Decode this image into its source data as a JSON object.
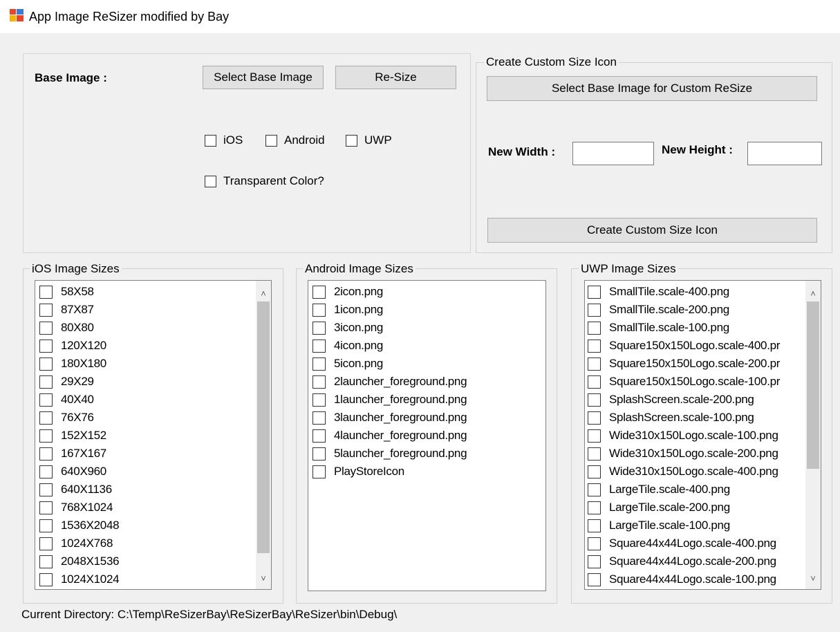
{
  "window": {
    "title": "App Image ReSizer modified by Bay",
    "icon": "app-icon"
  },
  "base_panel": {
    "label": "Base Image :",
    "select_button": "Select Base Image",
    "resize_button": "Re-Size",
    "platforms": [
      {
        "label": "iOS",
        "checked": false
      },
      {
        "label": "Android",
        "checked": false
      },
      {
        "label": "UWP",
        "checked": false
      }
    ],
    "transparent_label": "Transparent Color?"
  },
  "custom": {
    "legend": "Create Custom Size Icon",
    "select_button": "Select Base Image for Custom ReSize",
    "width_label": "New Width :",
    "height_label": "New Height :",
    "width_value": "",
    "height_value": "",
    "create_button": "Create Custom Size Icon"
  },
  "ios": {
    "legend": "iOS Image Sizes",
    "items": [
      "58X58",
      "87X87",
      "80X80",
      "120X120",
      "180X180",
      "29X29",
      "40X40",
      "76X76",
      "152X152",
      "167X167",
      "640X960",
      "640X1136",
      "768X1024",
      "1536X2048",
      "1024X768",
      "2048X1536",
      "1024X1024"
    ]
  },
  "android": {
    "legend": "Android Image Sizes",
    "items": [
      "2icon.png",
      "1icon.png",
      "3icon.png",
      "4icon.png",
      "5icon.png",
      "2launcher_foreground.png",
      "1launcher_foreground.png",
      "3launcher_foreground.png",
      "4launcher_foreground.png",
      "5launcher_foreground.png",
      "PlayStoreIcon"
    ]
  },
  "uwp": {
    "legend": "UWP Image Sizes",
    "items": [
      "SmallTile.scale-400.png",
      "SmallTile.scale-200.png",
      "SmallTile.scale-100.png",
      "Square150x150Logo.scale-400.pr",
      "Square150x150Logo.scale-200.pr",
      "Square150x150Logo.scale-100.pr",
      "SplashScreen.scale-200.png",
      "SplashScreen.scale-100.png",
      "Wide310x150Logo.scale-100.png",
      "Wide310x150Logo.scale-200.png",
      "Wide310x150Logo.scale-400.png",
      "LargeTile.scale-400.png",
      "LargeTile.scale-200.png",
      "LargeTile.scale-100.png",
      "Square44x44Logo.scale-400.png",
      "Square44x44Logo.scale-200.png",
      "Square44x44Logo.scale-100.png"
    ]
  },
  "status": {
    "text": "Current Directory: C:\\Temp\\ReSizerBay\\ReSizerBay\\ReSizer\\bin\\Debug\\"
  }
}
